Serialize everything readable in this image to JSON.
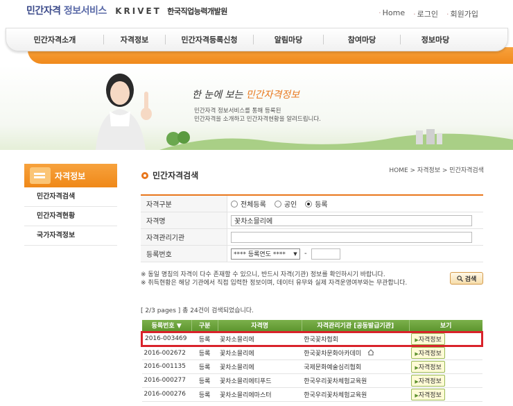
{
  "header": {
    "logo_part1": "민간자격",
    "logo_part2": "정보서비스",
    "logo_krivet": "KRIVET",
    "logo_org": "한국직업능력개발원",
    "util_links": [
      "Home",
      "로그인",
      "회원가입"
    ]
  },
  "gnb": {
    "items": [
      "민간자격소개",
      "자격정보",
      "민간자격등록신청",
      "알림마당",
      "참여마당",
      "정보마당"
    ]
  },
  "visual": {
    "title_prefix": "한 눈에 보는",
    "title_highlight": "민간자격정보",
    "desc_line1": "민간자격 정보서비스를 통해 등록된",
    "desc_line2": "민간자격을 소개하고 민간자격현황을 알려드립니다."
  },
  "lnb": {
    "title": "자격정보",
    "items": [
      "민간자격검색",
      "민간자격현황",
      "국가자격정보"
    ]
  },
  "content": {
    "page_title": "민간자격검색",
    "breadcrumb": "HOME > 자격정보 > 민간자격검색"
  },
  "search": {
    "rows": {
      "type_label": "자격구분",
      "name_label": "자격명",
      "org_label": "자격관리기관",
      "regno_label": "등록번호"
    },
    "type_options": [
      "전체등록",
      "공인",
      "등록"
    ],
    "type_selected": "등록",
    "name_value": "꽃차소믈리에",
    "org_value": "",
    "regno_select": "**** 등록연도 ****",
    "regno_dash": "-",
    "regno_value": "",
    "notes": [
      "※ 동일 명칭의 자격이 다수 존재할 수 있으니, 반드시 자격(기관) 정보를 확인하시기 바랍니다.",
      "※ 취득현황은 해당 기관에서 직접 입력한 정보이며, 데이터 유무와 실제 자격운영여부와는 무관합니다."
    ],
    "button_label": "검색"
  },
  "results": {
    "info": "[ 2/3 pages ] 총 24건이 검색되었습니다.",
    "columns": [
      "등록번호 ▼",
      "구분",
      "자격명",
      "자격관리기관 [공동발급기관]",
      "보기"
    ],
    "rows": [
      {
        "regno": "2016-003469",
        "type": "등록",
        "name": "꽃차소믈리에",
        "org": "한국꽃차협회",
        "view": "자격정보"
      },
      {
        "regno": "2016-002672",
        "type": "등록",
        "name": "꽃차소믈리에",
        "org": "한국꽃차문화아카데미",
        "view": "자격정보"
      },
      {
        "regno": "2016-001135",
        "type": "등록",
        "name": "꽃차소믈리에",
        "org": "국제문화예술심리협회",
        "view": "자격정보"
      },
      {
        "regno": "2016-000277",
        "type": "등록",
        "name": "꽃차소믈리에티푸드",
        "org": "한국우리꽃차체험교육원",
        "view": "자격정보"
      },
      {
        "regno": "2016-000276",
        "type": "등록",
        "name": "꽃차소믈리에마스터",
        "org": "한국우리꽃차체험교육원",
        "view": "자격정보"
      }
    ],
    "highlight_row": 0
  }
}
